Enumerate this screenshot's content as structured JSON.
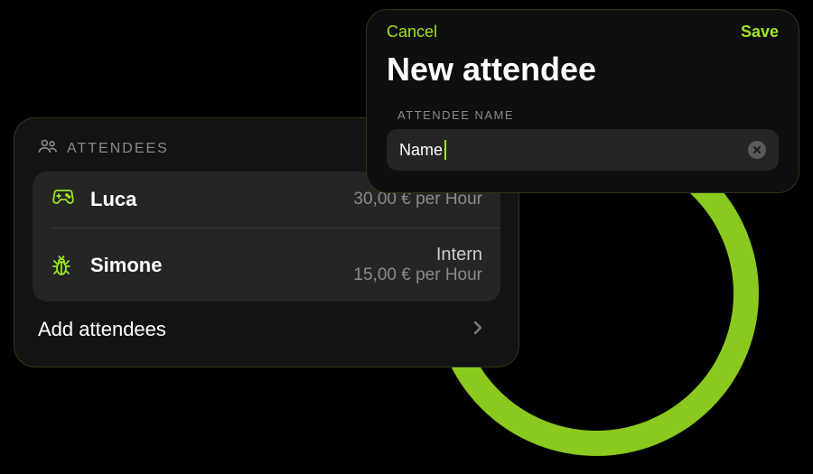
{
  "attendees_card": {
    "header": "ATTENDEES",
    "rows": [
      {
        "name": "Luca",
        "role": "",
        "rate": "30,00 € per Hour",
        "icon": "gamepad"
      },
      {
        "name": "Simone",
        "role": "Intern",
        "rate": "15,00 € per Hour",
        "icon": "bug"
      }
    ],
    "add_label": "Add attendees"
  },
  "modal": {
    "cancel": "Cancel",
    "save": "Save",
    "title": "New attendee",
    "field_label": "ATTENDEE NAME",
    "input_value": "Name",
    "placeholder": "Name"
  },
  "colors": {
    "accent": "#9FE51F",
    "ring": "#8BC91F",
    "card_bg": "#131313",
    "inset_bg": "#252525"
  }
}
